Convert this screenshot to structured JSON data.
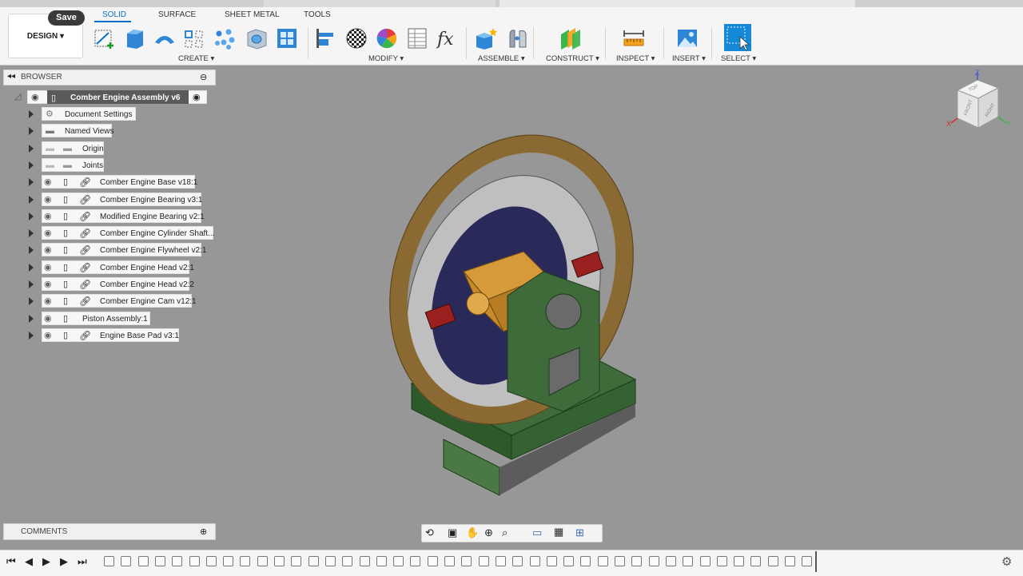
{
  "toolbar": {
    "save_tooltip": "Save",
    "workspace_label": "DESIGN",
    "tabs": [
      "SOLID",
      "SURFACE",
      "SHEET METAL",
      "TOOLS"
    ],
    "groups": [
      "CREATE",
      "MODIFY",
      "ASSEMBLE",
      "CONSTRUCT",
      "INSPECT",
      "INSERT",
      "SELECT"
    ]
  },
  "browser": {
    "title": "BROWSER",
    "root": "Comber Engine Assembly v6",
    "items": [
      "Document Settings",
      "Named Views",
      "Origin",
      "Joints",
      "Comber Engine Base v18:1",
      "Comber Engine Bearing v3:1",
      "Modified Engine Bearing v2:1",
      "Comber Engine Cylinder Shaft...",
      "Comber Engine Flywheel v2:1",
      "Comber Engine Head v2:1",
      "Comber Engine Head v2:2",
      "Comber Engine Cam v12:1",
      "Piston Assembly:1",
      "Engine Base Pad v3:1"
    ]
  },
  "comments": {
    "title": "COMMENTS"
  },
  "viewcube": {
    "faces": [
      "FRONT",
      "RIGHT",
      "TOP"
    ],
    "axes": [
      "Z",
      "X",
      "Y"
    ]
  },
  "colors": {
    "accent": "#0a6fc2",
    "viewport": "#979797",
    "base_green": "#3f6b3a",
    "flywheel": "#8a6a32",
    "block": "#c98a2a"
  }
}
